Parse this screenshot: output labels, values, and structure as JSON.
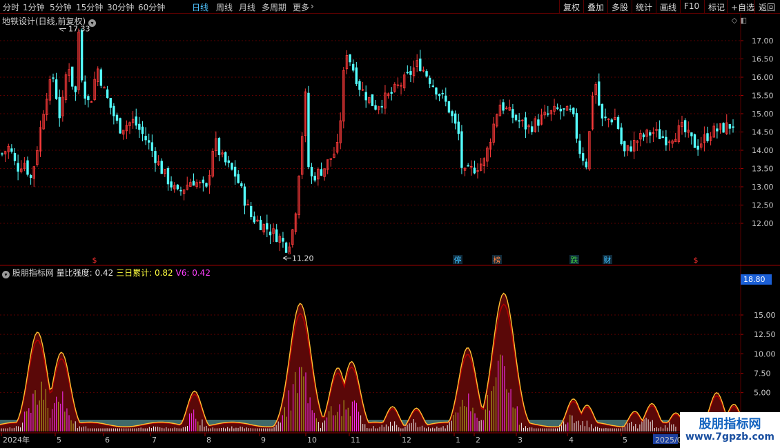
{
  "toolbar": {
    "periods": [
      "分时",
      "1分钟",
      "5分钟",
      "15分钟",
      "30分钟",
      "60分钟",
      "日线",
      "周线",
      "月线",
      "多周期",
      "更多"
    ],
    "active_period": "日线",
    "more_arrow": "›",
    "right_buttons": [
      "复权",
      "叠加",
      "多股",
      "统计",
      "画线",
      "F10",
      "标记",
      "+自选",
      "返回"
    ]
  },
  "main_chart": {
    "title": "地铁设计(日线,前复权)",
    "high_label": "17.33",
    "low_label": "11.20",
    "price_ticks": [
      "17.00",
      "16.50",
      "16.00",
      "15.50",
      "15.00",
      "14.50",
      "14.00",
      "13.50",
      "13.00",
      "12.50",
      "12.00"
    ],
    "markers": [
      {
        "text": "$",
        "color": "#ff3030"
      },
      {
        "text": "停",
        "color": "#40c0ff"
      },
      {
        "text": "榜",
        "color": "#ff8040"
      },
      {
        "text": "跌",
        "color": "#40d040"
      },
      {
        "text": "财",
        "color": "#40c0ff"
      },
      {
        "text": "$",
        "color": "#ff3030"
      }
    ]
  },
  "indicator": {
    "name": "股朋指标网",
    "s1_label": "量比强度:",
    "s1_value": "0.42",
    "s2_label": "三日累计:",
    "s2_value": "0.82",
    "s3_label": "V6:",
    "s3_value": "0.42",
    "current_label": "18.80",
    "ticks": [
      "15.00",
      "12.50",
      "10.00",
      "7.50",
      "5.00"
    ],
    "colors": {
      "s1": "#e0e0e0",
      "s2": "#ffff40",
      "s3": "#ff40ff"
    }
  },
  "axis": {
    "labels": [
      "2024年",
      "5",
      "6",
      "7",
      "8",
      "9",
      "10",
      "11",
      "12",
      "1",
      "2",
      "3",
      "4",
      "5",
      "2025/0"
    ]
  },
  "colors": {
    "up": "#ff3b3b",
    "down": "#54ffff",
    "grid": "#5a0000",
    "bg": "#000000"
  },
  "watermark": {
    "line1": "股朋指标网",
    "line2": "www.7gpzb.com"
  },
  "chart_data": {
    "type": "candlestick",
    "y_range": [
      11.2,
      17.33
    ],
    "close_path": [
      [
        0,
        13.9
      ],
      [
        0.01,
        14.1
      ],
      [
        0.02,
        13.5
      ],
      [
        0.03,
        13.7
      ],
      [
        0.04,
        13.2
      ],
      [
        0.05,
        14.3
      ],
      [
        0.06,
        15.5
      ],
      [
        0.07,
        16.0
      ],
      [
        0.08,
        14.8
      ],
      [
        0.09,
        16.5
      ],
      [
        0.1,
        15.4
      ],
      [
        0.105,
        17.33
      ],
      [
        0.11,
        15.8
      ],
      [
        0.12,
        15.2
      ],
      [
        0.13,
        16.3
      ],
      [
        0.14,
        15.6
      ],
      [
        0.16,
        14.6
      ],
      [
        0.18,
        14.8
      ],
      [
        0.2,
        14.2
      ],
      [
        0.22,
        13.4
      ],
      [
        0.24,
        12.8
      ],
      [
        0.26,
        13.2
      ],
      [
        0.28,
        12.9
      ],
      [
        0.29,
        14.3
      ],
      [
        0.3,
        13.8
      ],
      [
        0.32,
        13.3
      ],
      [
        0.34,
        12.2
      ],
      [
        0.36,
        11.9
      ],
      [
        0.38,
        11.6
      ],
      [
        0.39,
        11.3
      ],
      [
        0.4,
        12.0
      ],
      [
        0.415,
        15.5
      ],
      [
        0.42,
        13.2
      ],
      [
        0.44,
        13.5
      ],
      [
        0.46,
        14.1
      ],
      [
        0.47,
        16.8
      ],
      [
        0.49,
        15.7
      ],
      [
        0.51,
        15.2
      ],
      [
        0.53,
        15.5
      ],
      [
        0.55,
        15.9
      ],
      [
        0.57,
        16.4
      ],
      [
        0.59,
        15.8
      ],
      [
        0.61,
        15.2
      ],
      [
        0.625,
        14.4
      ],
      [
        0.63,
        13.3
      ],
      [
        0.66,
        13.7
      ],
      [
        0.68,
        15.3
      ],
      [
        0.7,
        14.9
      ],
      [
        0.72,
        14.6
      ],
      [
        0.74,
        14.9
      ],
      [
        0.76,
        15.1
      ],
      [
        0.78,
        15.0
      ],
      [
        0.79,
        14.0
      ],
      [
        0.8,
        13.6
      ],
      [
        0.81,
        16.1
      ],
      [
        0.82,
        14.8
      ],
      [
        0.84,
        14.9
      ],
      [
        0.85,
        13.9
      ],
      [
        0.87,
        14.3
      ],
      [
        0.89,
        14.5
      ],
      [
        0.91,
        14.3
      ],
      [
        0.93,
        14.6
      ],
      [
        0.95,
        14.1
      ],
      [
        0.97,
        14.5
      ],
      [
        1.0,
        14.7
      ]
    ],
    "indicator_peaks": [
      [
        0.055,
        12.8
      ],
      [
        0.09,
        10.2
      ],
      [
        0.285,
        5.2
      ],
      [
        0.44,
        16.5
      ],
      [
        0.495,
        8.2
      ],
      [
        0.515,
        9.0
      ],
      [
        0.575,
        3.2
      ],
      [
        0.61,
        3.0
      ],
      [
        0.685,
        10.8
      ],
      [
        0.738,
        17.8
      ],
      [
        0.84,
        4.2
      ],
      [
        0.86,
        3.4
      ],
      [
        0.93,
        2.6
      ],
      [
        0.955,
        3.6
      ],
      [
        0.99,
        2.4
      ],
      [
        1.05,
        5.0
      ],
      [
        1.075,
        3.5
      ]
    ]
  }
}
